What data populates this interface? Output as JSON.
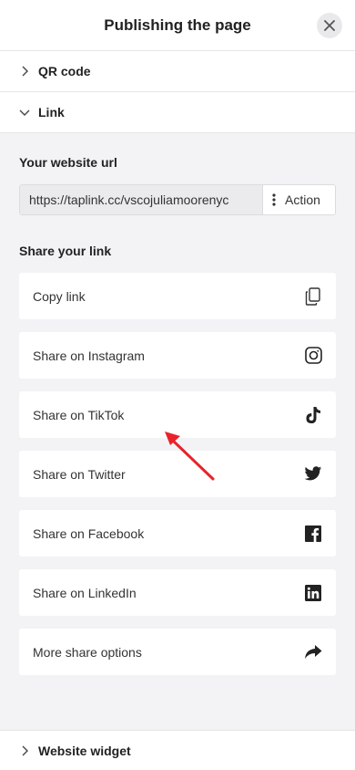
{
  "header": {
    "title": "Publishing the page"
  },
  "sections": {
    "qr": "QR code",
    "link": "Link",
    "widget": "Website widget"
  },
  "url": {
    "title": "Your website url",
    "value": "https://taplink.cc/vscojuliamoorenyc",
    "action_label": "Action"
  },
  "share": {
    "title": "Share your link",
    "items": [
      {
        "label": "Copy link",
        "icon": "copy-icon"
      },
      {
        "label": "Share on Instagram",
        "icon": "instagram-icon"
      },
      {
        "label": "Share on TikTok",
        "icon": "tiktok-icon"
      },
      {
        "label": "Share on Twitter",
        "icon": "twitter-icon"
      },
      {
        "label": "Share on Facebook",
        "icon": "facebook-icon"
      },
      {
        "label": "Share on LinkedIn",
        "icon": "linkedin-icon"
      },
      {
        "label": "More share options",
        "icon": "share-arrow-icon"
      }
    ]
  },
  "colors": {
    "annotation_arrow": "#e8232a",
    "panel_bg": "#f3f3f6"
  }
}
